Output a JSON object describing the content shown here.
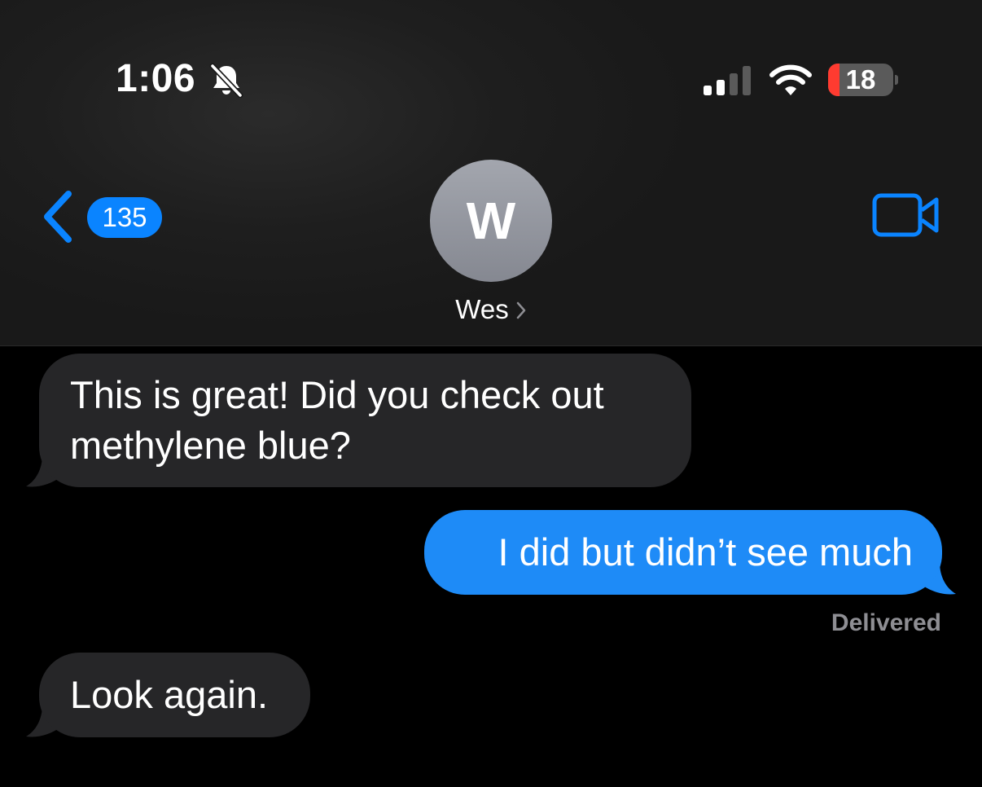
{
  "status_bar": {
    "time": "1:06",
    "silent_icon": "bell-slash-icon",
    "signal_icon": "cellular-signal-icon",
    "signal_bars_active": 2,
    "signal_bars_total": 4,
    "wifi_icon": "wifi-icon",
    "battery_level": "18",
    "battery_fraction": 0.18,
    "battery_color": "#ff3b30"
  },
  "nav": {
    "back_icon": "chevron-left-icon",
    "unread_count": "135",
    "contact_initial": "W",
    "contact_name": "Wes",
    "contact_chevron_icon": "chevron-right-icon",
    "video_icon": "video-camera-icon",
    "accent_color": "#0a84ff"
  },
  "messages": [
    {
      "direction": "received",
      "text": "This is great! Did you check out methylene blue?"
    },
    {
      "direction": "sent",
      "text": "I did but didn’t see much"
    },
    {
      "direction": "received",
      "text": "Look again."
    }
  ],
  "delivery_status": "Delivered",
  "colors": {
    "sent_bubble": "#1e8bf7",
    "received_bubble": "#262628",
    "background": "#000000"
  }
}
